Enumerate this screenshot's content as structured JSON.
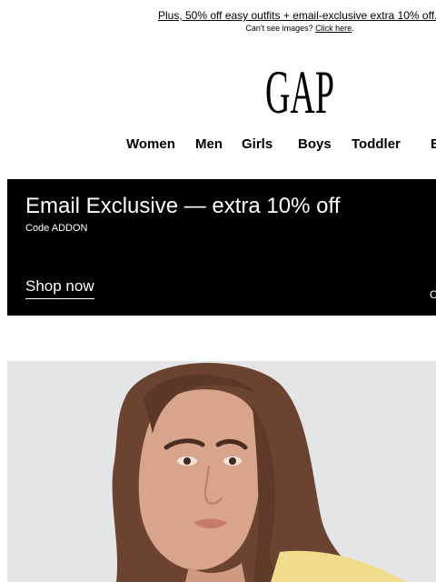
{
  "preheader": {
    "promo_link": "Plus, 50% off easy outfits + email-exclusive extra 10% off.",
    "cant_see_text": "Can't see images?",
    "click_here": "Click here",
    "period": "."
  },
  "brand": {
    "logo_text": "GAP"
  },
  "nav": {
    "items": [
      "Women",
      "Men",
      "Girls",
      "Boys",
      "Toddler",
      "B"
    ]
  },
  "banner": {
    "headline": "Email Exclusive — extra 10% off",
    "code": "Code ADDON",
    "cta": "Shop now",
    "edge_char": "C",
    "background": "#000000",
    "text_color": "#ffffff"
  },
  "hero": {
    "image_alt": "Model with long brown hair in a pale yellow top"
  }
}
